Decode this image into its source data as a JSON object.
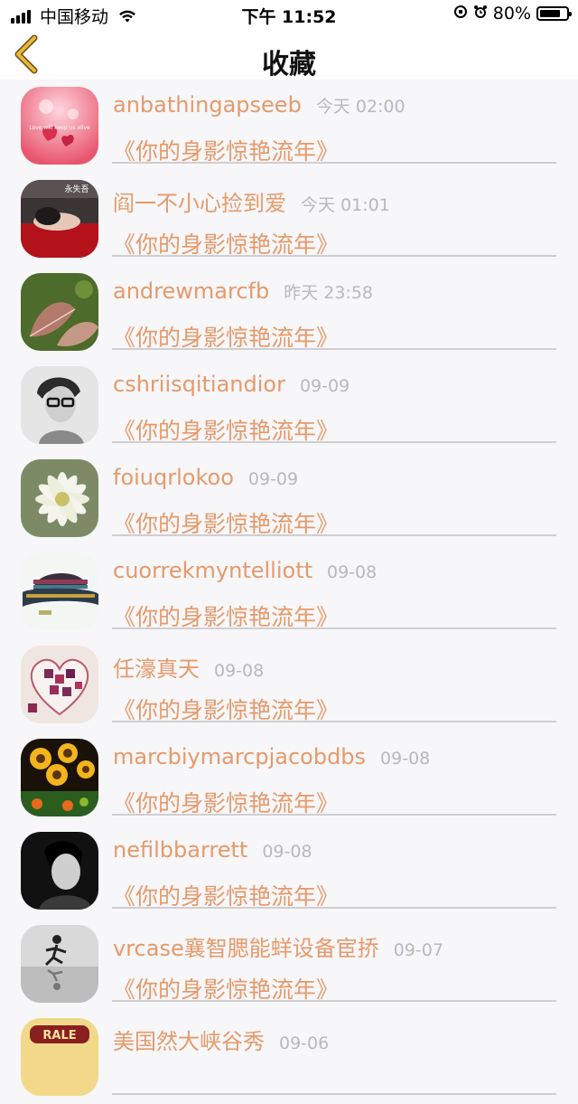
{
  "status_bar": {
    "carrier": "中国移动",
    "time": "下午 11:52",
    "battery": "80%",
    "battery_level": 0.8
  },
  "nav": {
    "title": "收藏",
    "back_icon": "chevron-left-icon"
  },
  "colors": {
    "accent": "#e59a6a",
    "back_arrow": "#d9a71e",
    "time_text": "#b9b9bd"
  },
  "favorites": [
    {
      "user": "anbathingapseeb",
      "time": "今天 02:00",
      "song": "《你的身影惊艳流年》",
      "avatar_text": "Love will keep us alive"
    },
    {
      "user": "阎一不小心捡到爱",
      "time": "今天 01:01",
      "song": "《你的身影惊艳流年》",
      "avatar_text": "永失吾"
    },
    {
      "user": "andrewmarcfb",
      "time": "昨天 23:58",
      "song": "《你的身影惊艳流年》"
    },
    {
      "user": "cshriisqitiandior",
      "time": "09-09",
      "song": "《你的身影惊艳流年》"
    },
    {
      "user": "foiuqrlokoo",
      "time": "09-09",
      "song": "《你的身影惊艳流年》"
    },
    {
      "user": "cuorrekmyntelliott",
      "time": "09-08",
      "song": "《你的身影惊艳流年》"
    },
    {
      "user": "任濠真天",
      "time": "09-08",
      "song": "《你的身影惊艳流年》"
    },
    {
      "user": "marcbiymarcpjacobdbs",
      "time": "09-08",
      "song": "《你的身影惊艳流年》"
    },
    {
      "user": "nefilbbarrett",
      "time": "09-08",
      "song": "《你的身影惊艳流年》"
    },
    {
      "user": "vrcase襄智腮能蛘设备宦挢",
      "time": "09-07",
      "song": "《你的身影惊艳流年》"
    },
    {
      "user": "美国然大峡谷秀",
      "time": "09-06",
      "song": "",
      "avatar_text": "RALE"
    }
  ]
}
